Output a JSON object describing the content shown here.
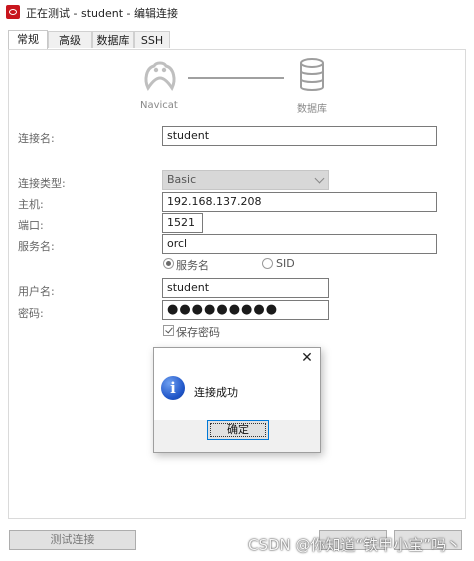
{
  "window": {
    "title": "正在测试 - student - 编辑连接"
  },
  "tabs": [
    "常规",
    "高级",
    "数据库",
    "SSH"
  ],
  "header": {
    "left_label": "Navicat",
    "right_label": "数据库"
  },
  "form": {
    "conn_name_label": "连接名:",
    "conn_name": "student",
    "conn_type_label": "连接类型:",
    "conn_type": "Basic",
    "host_label": "主机:",
    "host": "192.168.137.208",
    "port_label": "端口:",
    "port": "1521",
    "service_label": "服务名:",
    "service": "orcl",
    "radio_service": "服务名",
    "radio_sid": "SID",
    "user_label": "用户名:",
    "user": "student",
    "password_label": "密码:",
    "password_mask": "●●●●●●●●●",
    "save_password": "保存密码"
  },
  "buttons": {
    "test": "测试连接"
  },
  "dialog": {
    "close": "✕",
    "message": "连接成功",
    "ok": "确定"
  },
  "watermark": "CSDN @你知道“铁甲小宝”吗丶",
  "colors": {
    "accent": "#0078d7",
    "app_icon": "#c8151d",
    "info_icon": "#1f55c8"
  }
}
